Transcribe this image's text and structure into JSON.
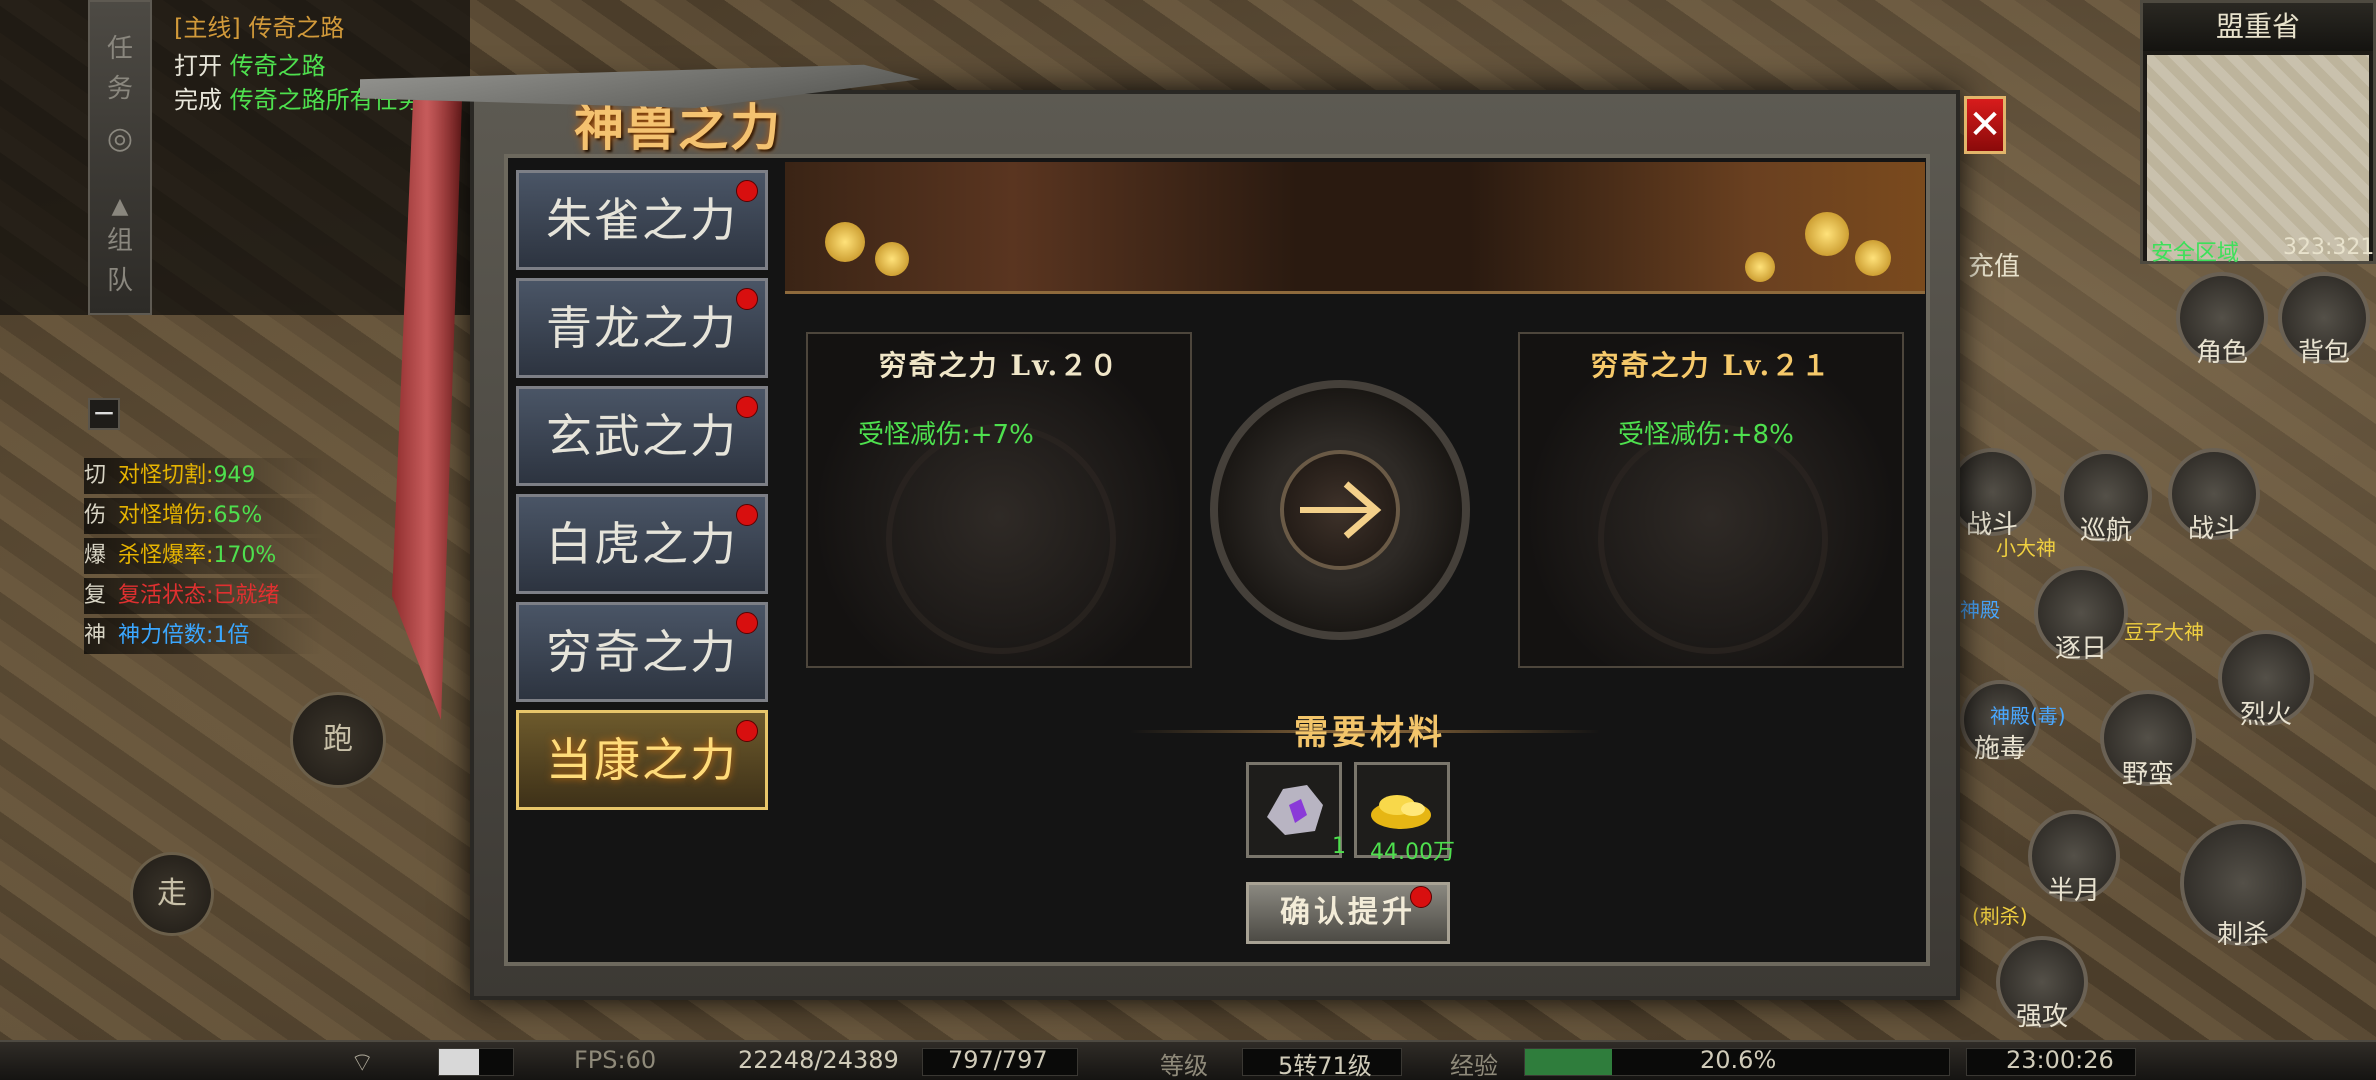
{
  "quest": {
    "tabs": [
      "任",
      "务",
      "组",
      "队"
    ],
    "line1_tag": "[主线]",
    "line1_name": "传奇之路",
    "line2_prefix": "打开",
    "line2_name": "传奇之路",
    "line3_prefix": "完成",
    "line3_name": "传奇之路所有任务"
  },
  "stats": [
    {
      "key": "切",
      "label": "对怪切割:",
      "value": "949",
      "color": "#4ee04e"
    },
    {
      "key": "伤",
      "label": "对怪增伤:",
      "value": "65%",
      "color": "#4ee04e"
    },
    {
      "key": "爆",
      "label": "杀怪爆率:",
      "value": "170%",
      "color": "#4ee04e"
    },
    {
      "key": "复",
      "label": "复活状态:",
      "value": "已就绪",
      "color": "#e03030"
    },
    {
      "key": "神",
      "label": "神力倍数:",
      "value": "1倍",
      "color": "#3aa7ff"
    }
  ],
  "left_buttons": {
    "run": "跑",
    "walk": "走",
    "minus": "−"
  },
  "minimap": {
    "title": "盟重省",
    "zone": "安全区域",
    "coords": "323:321"
  },
  "window": {
    "title": "神兽之力",
    "close": "✕"
  },
  "tabs": [
    {
      "label": "朱雀之力",
      "badge": true,
      "active": false
    },
    {
      "label": "青龙之力",
      "badge": true,
      "active": false
    },
    {
      "label": "玄武之力",
      "badge": true,
      "active": false
    },
    {
      "label": "白虎之力",
      "badge": true,
      "active": false
    },
    {
      "label": "穷奇之力",
      "badge": true,
      "active": false
    },
    {
      "label": "当康之力",
      "badge": true,
      "active": true
    }
  ],
  "current": {
    "title": "穷奇之力 Lv.２０",
    "stat": "受怪减伤:+7%"
  },
  "next": {
    "title": "穷奇之力 Lv.２１",
    "stat": "受怪减伤:+8%"
  },
  "materials": {
    "title": "需要材料",
    "items": [
      {
        "icon": "crystal-ore-icon",
        "count": "1"
      },
      {
        "icon": "gold-coins-icon",
        "count": "44.00万"
      }
    ],
    "confirm_label": "确认提升"
  },
  "bottom": {
    "fps": "FPS:60",
    "hp": "22248/24389",
    "mp": "797/797",
    "level_label": "等级",
    "level": "5转71级",
    "exp_label": "经验",
    "exp": "20.6%",
    "exp_fraction": 0.206,
    "time": "23:00:26"
  },
  "right": {
    "top_label": "充值",
    "skills": [
      "角色",
      "背包",
      "战斗",
      "巡航",
      "战斗",
      "逐日",
      "烈火",
      "野蛮",
      "施毒",
      "半月",
      "刺杀",
      "强攻"
    ],
    "names": [
      "小大神",
      "神殿",
      "豆子大神",
      "神殿(毒)",
      "(刺杀)"
    ]
  }
}
